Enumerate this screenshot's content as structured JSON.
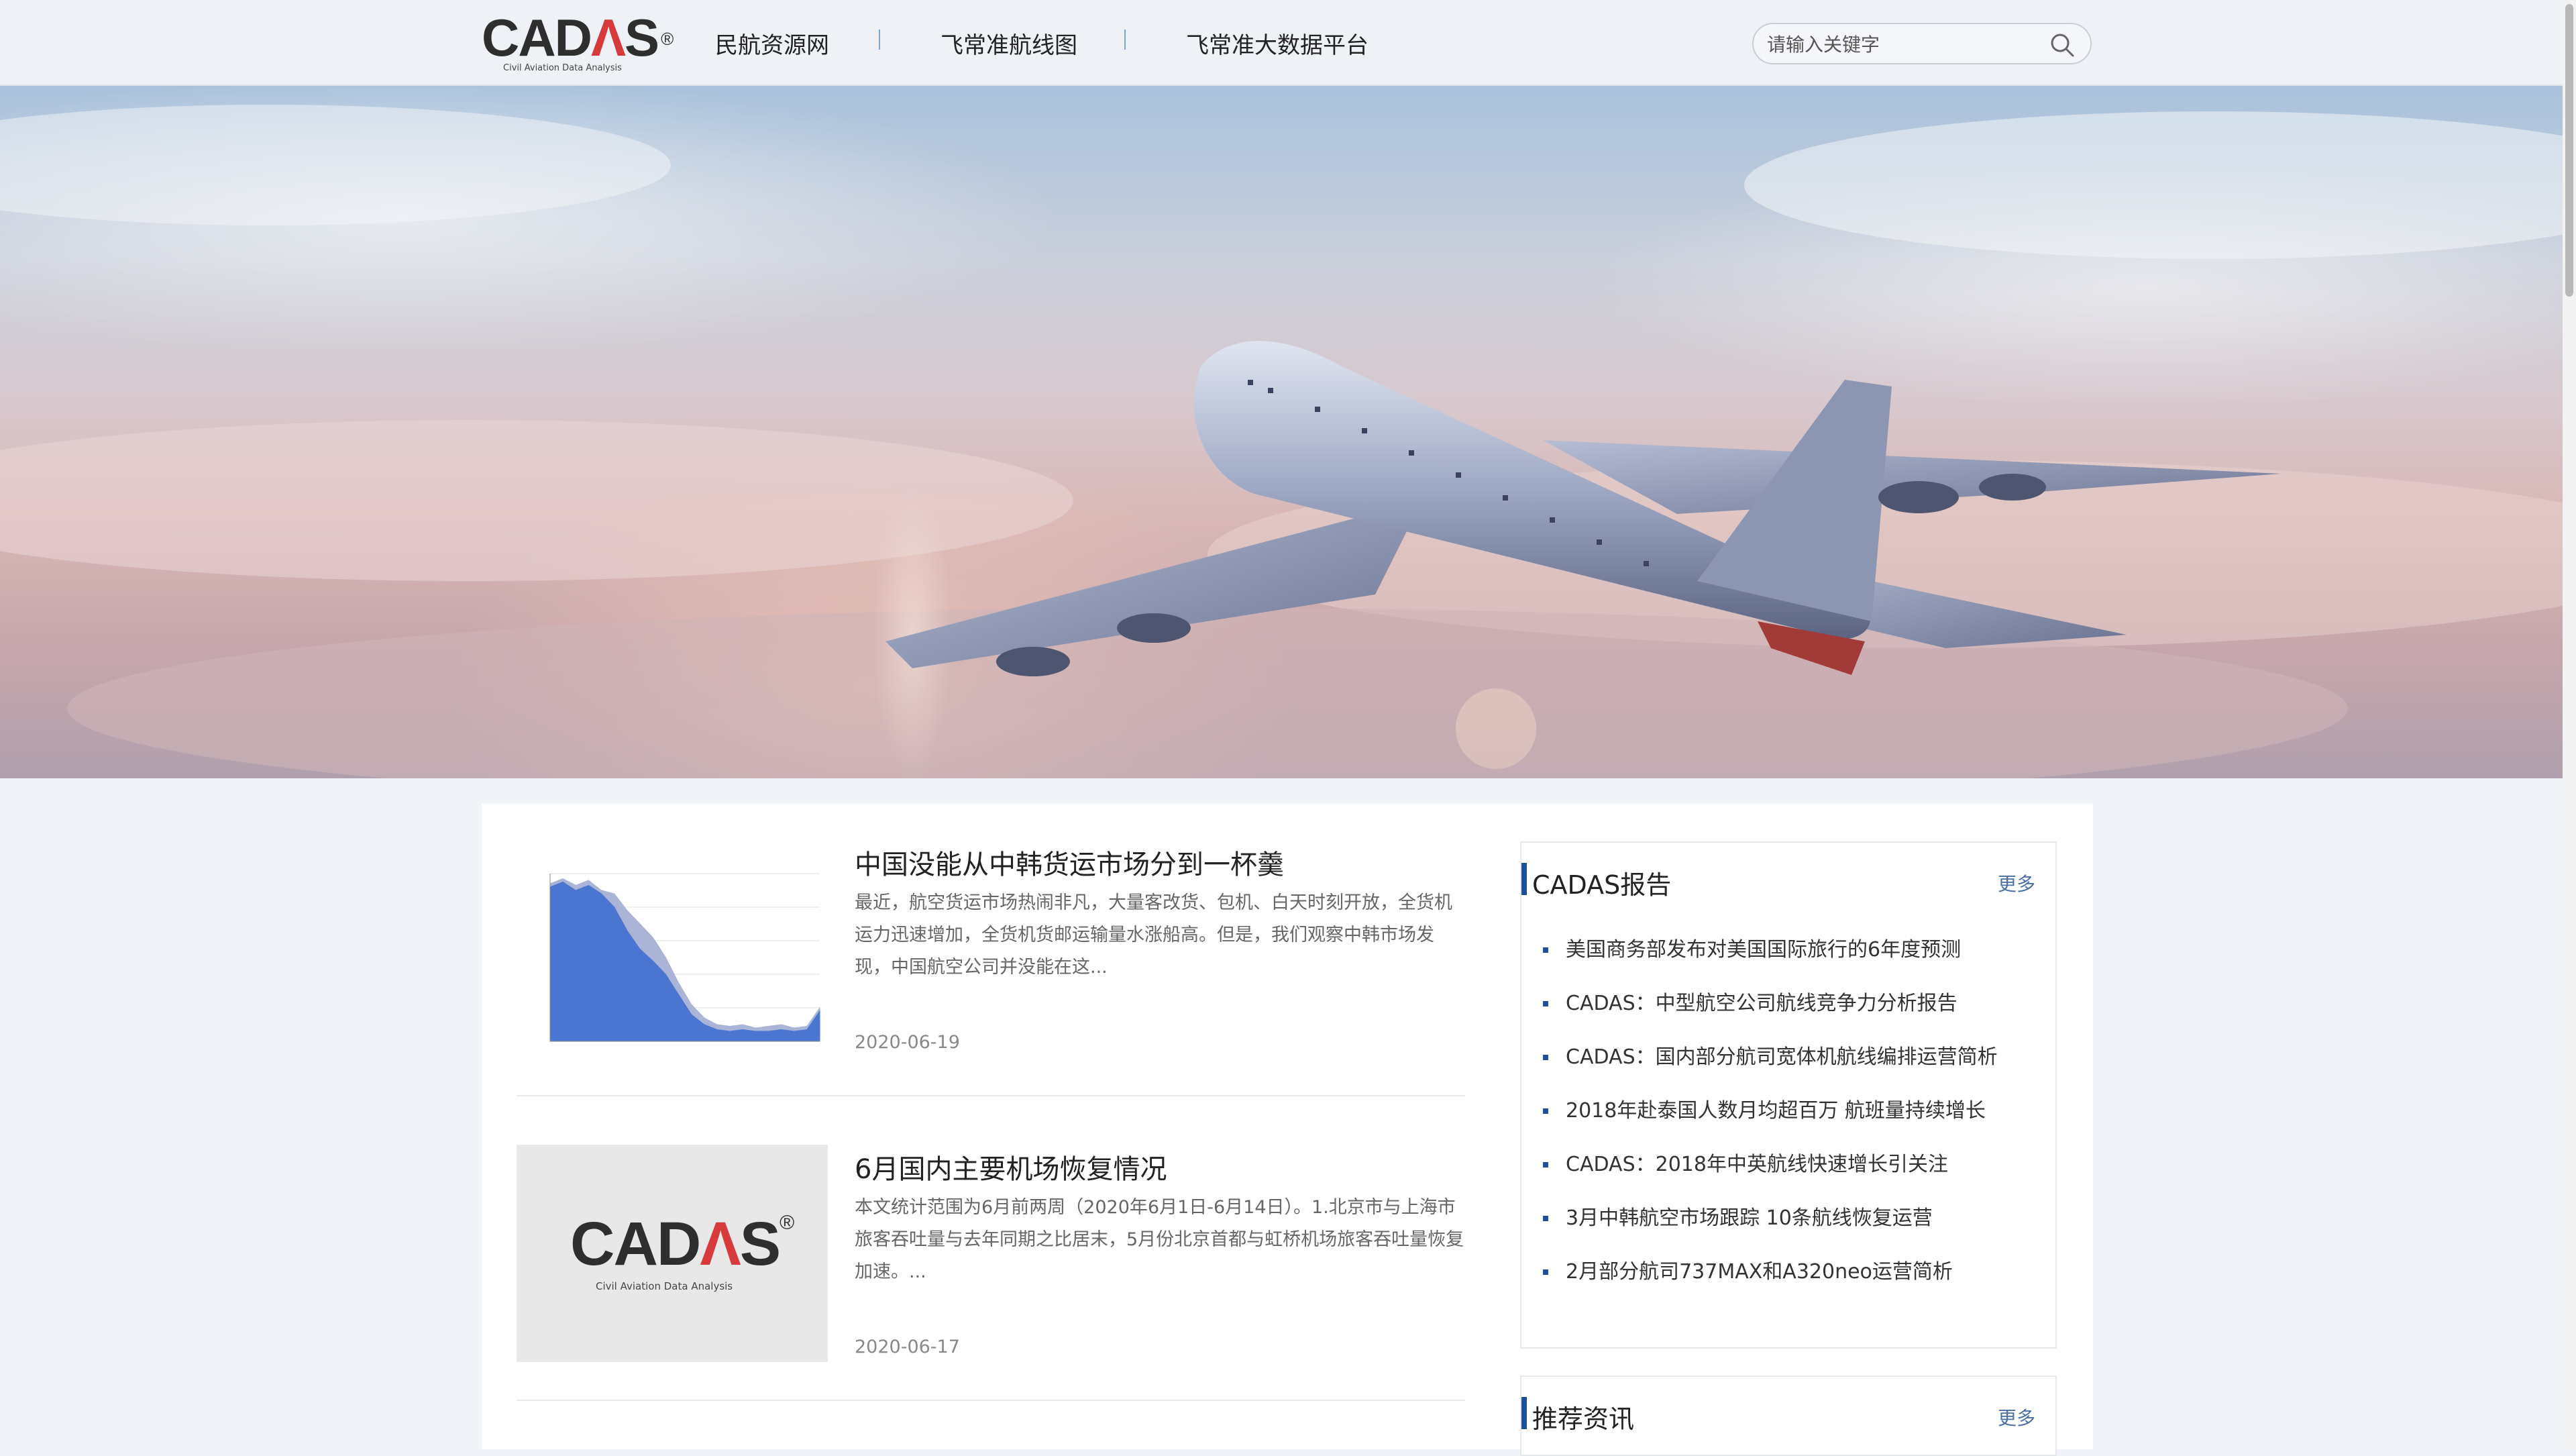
{
  "header": {
    "logo_text_parts": [
      "CAD",
      "Λ",
      "S"
    ],
    "logo_reg": "®",
    "logo_subtitle": "Civil Aviation Data Analysis",
    "nav": [
      {
        "label": "民航资源网"
      },
      {
        "label": "飞常准航线图"
      },
      {
        "label": "飞常准大数据平台"
      }
    ],
    "search_placeholder": "请输入关键字",
    "search_value": ""
  },
  "articles": [
    {
      "title": "中国没能从中韩货运市场分到一杯羹",
      "summary": "最近，航空货运市场热闹非凡，大量客改货、包机、白天时刻开放，全货机运力迅速增加，全货机货邮运输量水涨船高。但是，我们观察中韩市场发现，中国航空公司并没能在这...",
      "date": "2020-06-19",
      "thumb_type": "chart"
    },
    {
      "title": "6月国内主要机场恢复情况",
      "summary": "本文统计范围为6月前两周（2020年6月1日-6月14日）。1.北京市与上海市旅客吞吐量与去年同期之比居末，5月份北京首都与虹桥机场旅客吞吐量恢复加速。...",
      "date": "2020-06-17",
      "thumb_type": "logo",
      "thumb_logo_parts": [
        "CAD",
        "Λ",
        "S"
      ],
      "thumb_logo_reg": "®",
      "thumb_logo_subtitle": "Civil Aviation Data Analysis"
    }
  ],
  "panels": [
    {
      "title": "CADAS报告",
      "more": "更多",
      "items": [
        "美国商务部发布对美国国际旅行的6年度预测",
        "CADAS：中型航空公司航线竞争力分析报告",
        "CADAS：国内部分航司宽体机航线编排运营简析",
        "2018年赴泰国人数月均超百万 航班量持续增长",
        "CADAS：2018年中英航线快速增长引关注",
        "3月中韩航空市场跟踪 10条航线恢复运营",
        "2月部分航司737MAX和A320neo运营简析"
      ]
    },
    {
      "title": "推荐资讯",
      "more": "更多",
      "items": []
    }
  ],
  "chart_data": {
    "type": "area",
    "series": [
      {
        "values": [
          0.94,
          0.97,
          0.93,
          0.96,
          0.9,
          0.88,
          0.78,
          0.7,
          0.62,
          0.5,
          0.35,
          0.22,
          0.14,
          0.1,
          0.09,
          0.1,
          0.08,
          0.09,
          0.1,
          0.08,
          0.09,
          0.2
        ],
        "color": "#aab4d6"
      },
      {
        "values": [
          0.92,
          0.95,
          0.9,
          0.93,
          0.88,
          0.8,
          0.66,
          0.55,
          0.48,
          0.4,
          0.28,
          0.16,
          0.1,
          0.07,
          0.06,
          0.07,
          0.06,
          0.06,
          0.07,
          0.06,
          0.07,
          0.18
        ],
        "color": "#4a76d2"
      }
    ],
    "ylim": [
      0,
      1
    ],
    "grid": true
  },
  "colors": {
    "accent": "#1f4f9c",
    "logo_red": "#d63a3a",
    "more_link": "#4a6fa5"
  }
}
